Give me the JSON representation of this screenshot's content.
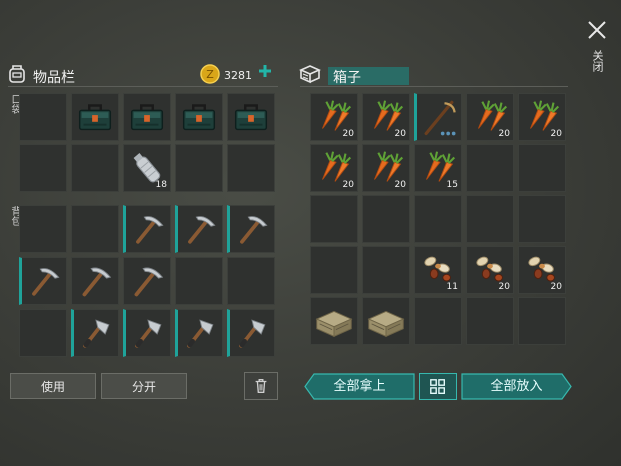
{
  "inventory": {
    "title": "物品栏",
    "coins": "3281",
    "pocket_label": "口袋",
    "backpack_label": "背包"
  },
  "chest": {
    "title": "箱子"
  },
  "buttons": {
    "use": "使用",
    "split": "分开",
    "take_all": "全部拿上",
    "put_all": "全部放入"
  },
  "close": {
    "label": "关闭"
  },
  "pocket_slots": [
    {
      "item": "empty"
    },
    {
      "item": "toolbox-icon"
    },
    {
      "item": "toolbox-icon"
    },
    {
      "item": "toolbox-icon"
    },
    {
      "item": "toolbox-icon"
    },
    {
      "item": "empty"
    },
    {
      "item": "empty"
    },
    {
      "item": "water-bottle-icon",
      "count": "18"
    },
    {
      "item": "empty"
    },
    {
      "item": "empty"
    }
  ],
  "backpack_slots": [
    {
      "item": "empty"
    },
    {
      "item": "empty"
    },
    {
      "item": "pickaxe-icon"
    },
    {
      "item": "pickaxe-icon"
    },
    {
      "item": "pickaxe-icon"
    },
    {
      "item": "pickaxe-icon"
    },
    {
      "item": "pickaxe-icon"
    },
    {
      "item": "pickaxe-icon"
    },
    {
      "item": "empty"
    },
    {
      "item": "empty"
    },
    {
      "item": "empty"
    },
    {
      "item": "hatchet-icon"
    },
    {
      "item": "hatchet-icon"
    },
    {
      "item": "hatchet-icon"
    },
    {
      "item": "hatchet-icon"
    }
  ],
  "chest_slots": [
    {
      "item": "carrot-icon",
      "count": "20"
    },
    {
      "item": "carrot-icon",
      "count": "20"
    },
    {
      "item": "crossbow-icon"
    },
    {
      "item": "carrot-icon",
      "count": "20"
    },
    {
      "item": "carrot-icon",
      "count": "20"
    },
    {
      "item": "carrot-icon",
      "count": "20"
    },
    {
      "item": "carrot-icon",
      "count": "20"
    },
    {
      "item": "carrot-icon",
      "count": "15"
    },
    {
      "item": "empty"
    },
    {
      "item": "empty"
    },
    {
      "item": "empty"
    },
    {
      "item": "empty"
    },
    {
      "item": "empty"
    },
    {
      "item": "empty"
    },
    {
      "item": "empty"
    },
    {
      "item": "empty"
    },
    {
      "item": "empty"
    },
    {
      "item": "seeds-icon",
      "count": "11"
    },
    {
      "item": "seeds-icon",
      "count": "20"
    },
    {
      "item": "seeds-icon",
      "count": "20"
    },
    {
      "item": "wood-crate-icon"
    },
    {
      "item": "wood-crate-icon"
    },
    {
      "item": "empty"
    },
    {
      "item": "empty"
    },
    {
      "item": "empty"
    }
  ],
  "colors": {
    "accent": "#1fa39a",
    "panel": "#2f312f"
  }
}
